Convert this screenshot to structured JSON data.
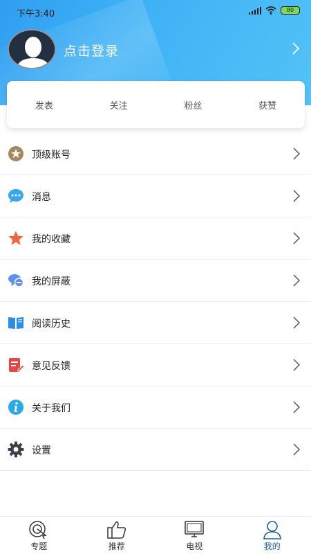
{
  "status_bar": {
    "time": "下午3:40",
    "battery": "80"
  },
  "profile": {
    "login_text": "点击登录"
  },
  "stats": [
    {
      "label": "发表"
    },
    {
      "label": "关注"
    },
    {
      "label": "粉丝"
    },
    {
      "label": "获赞"
    }
  ],
  "menu": [
    {
      "label": "顶级账号",
      "icon": "star-badge-icon",
      "color": "#a38a5c"
    },
    {
      "label": "消息",
      "icon": "chat-bubble-icon",
      "color": "#39a7ee"
    },
    {
      "label": "我的收藏",
      "icon": "star-icon",
      "color": "#f0683a"
    },
    {
      "label": "我的屏蔽",
      "icon": "block-chat-icon",
      "color": "#5b8ff2"
    },
    {
      "label": "阅读历史",
      "icon": "open-book-icon",
      "color": "#2f8be8"
    },
    {
      "label": "意见反馈",
      "icon": "feedback-doc-icon",
      "color": "#e84545"
    },
    {
      "label": "关于我们",
      "icon": "info-icon",
      "color": "#2aa9e8"
    },
    {
      "label": "设置",
      "icon": "gear-icon",
      "color": "#3a3f4a"
    }
  ],
  "tabs": [
    {
      "label": "专题",
      "icon": "target-icon"
    },
    {
      "label": "推荐",
      "icon": "thumbs-up-icon"
    },
    {
      "label": "电视",
      "icon": "tv-icon"
    },
    {
      "label": "我的",
      "icon": "person-icon",
      "active": true
    }
  ]
}
